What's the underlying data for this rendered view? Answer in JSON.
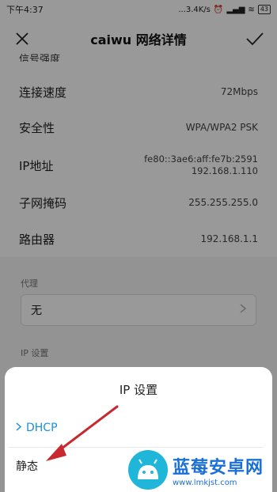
{
  "statusbar": {
    "time": "下午4:37",
    "network_speed": "...3.4K/s",
    "battery": "43"
  },
  "header": {
    "title": "caiwu  网络详情"
  },
  "partial_row": "信号强度",
  "details": [
    {
      "label": "连接速度",
      "value": "72Mbps"
    },
    {
      "label": "安全性",
      "value": "WPA/WPA2 PSK"
    },
    {
      "label": "IP地址",
      "value_lines": [
        "fe80::3ae6:aff:fe7b:2591",
        "192.168.1.110"
      ]
    },
    {
      "label": "子网掩码",
      "value": "255.255.255.0"
    },
    {
      "label": "路由器",
      "value": "192.168.1.1"
    }
  ],
  "proxy": {
    "section_label": "代理",
    "value": "无"
  },
  "ip_settings": {
    "section_label": "IP 设置"
  },
  "sheet": {
    "title": "IP  设置",
    "options": [
      {
        "label": "DHCP",
        "selected": true
      },
      {
        "label": "静态",
        "selected": false
      }
    ]
  },
  "watermark": {
    "title": "蓝莓安卓网",
    "url": "www.lmkjst.com"
  },
  "colors": {
    "accent": "#1a8fe0",
    "arrow": "#c8282e",
    "watermark": "#1a6fd6"
  }
}
